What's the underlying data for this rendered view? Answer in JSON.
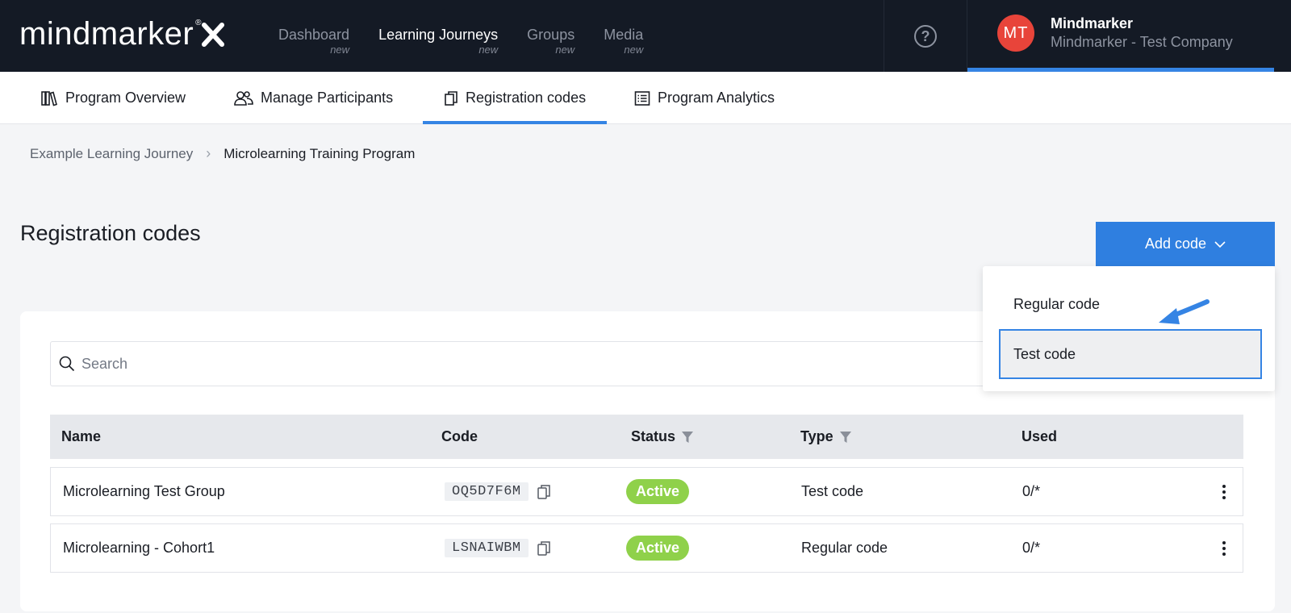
{
  "logo": {
    "text": "mindmarker",
    "reg": "®",
    "mark": "X"
  },
  "nav": [
    {
      "label": "Dashboard",
      "sub": "new",
      "active": false
    },
    {
      "label": "Learning Journeys",
      "sub": "new",
      "active": true
    },
    {
      "label": "Groups",
      "sub": "new",
      "active": false
    },
    {
      "label": "Media",
      "sub": "new",
      "active": false
    }
  ],
  "help": {
    "glyph": "?",
    "icon": "question-circle-icon"
  },
  "user": {
    "initials": "MT",
    "name": "Mindmarker",
    "company": "Mindmarker - Test Company",
    "avatar_color": "#e8443a"
  },
  "subtabs": [
    {
      "label": "Program Overview",
      "icon": "books-icon"
    },
    {
      "label": "Manage Participants",
      "icon": "users-icon"
    },
    {
      "label": "Registration codes",
      "icon": "copy-pages-icon",
      "active": true
    },
    {
      "label": "Program Analytics",
      "icon": "list-icon"
    }
  ],
  "breadcrumb": {
    "parent": "Example Learning Journey",
    "separator": "›",
    "current": "Microlearning Training Program"
  },
  "page": {
    "title": "Registration codes"
  },
  "add_button": {
    "label": "Add code",
    "color": "#2f7fe0"
  },
  "dropdown": {
    "items": [
      "Regular code",
      "Test code"
    ],
    "highlighted": "Test code"
  },
  "search": {
    "placeholder": "Search",
    "value": ""
  },
  "table": {
    "headers": {
      "name": "Name",
      "code": "Code",
      "status": "Status",
      "type": "Type",
      "used": "Used"
    },
    "rows": [
      {
        "name": "Microlearning Test Group",
        "code": "OQ5D7F6M",
        "status": "Active",
        "type": "Test code",
        "used": "0/*"
      },
      {
        "name": "Microlearning - Cohort1",
        "code": "LSNAIWBM",
        "status": "Active",
        "type": "Regular code",
        "used": "0/*"
      }
    ]
  },
  "colors": {
    "accent": "#3584e4",
    "topbar": "#141a25",
    "active_badge": "#8fd14a"
  }
}
